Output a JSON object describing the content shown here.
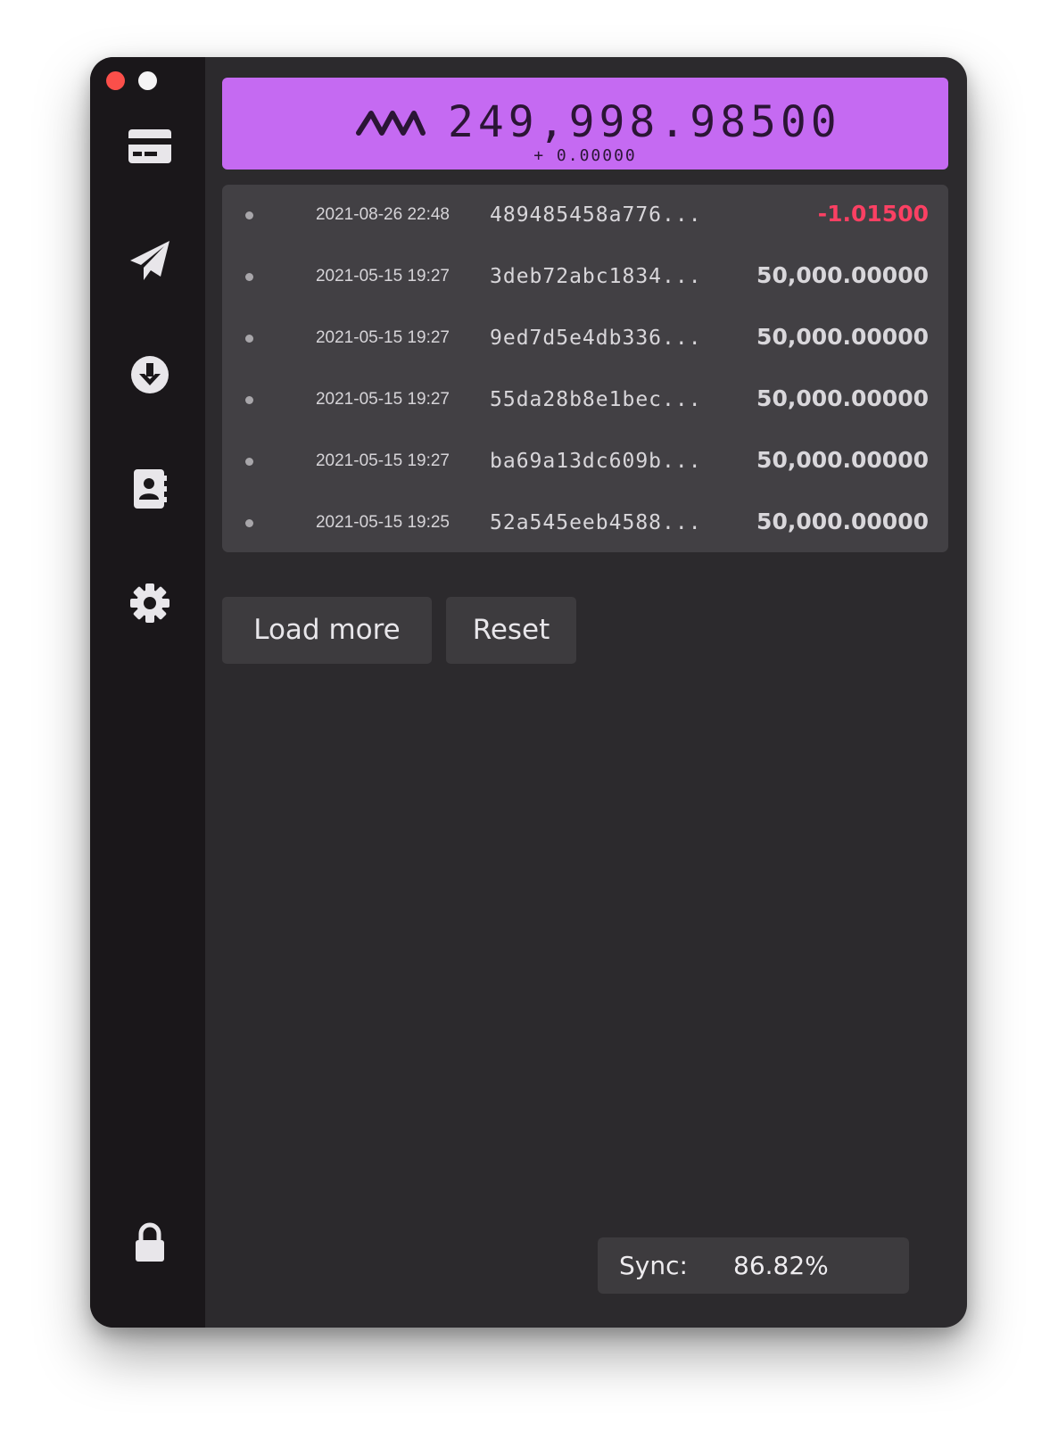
{
  "window": {
    "controls": [
      "close",
      "minimize"
    ]
  },
  "sidebar": {
    "items": [
      {
        "icon": "card-icon",
        "name": "wallet"
      },
      {
        "icon": "paper-plane-icon",
        "name": "send"
      },
      {
        "icon": "download-icon",
        "name": "receive"
      },
      {
        "icon": "contacts-icon",
        "name": "contacts"
      },
      {
        "icon": "gear-icon",
        "name": "settings"
      }
    ],
    "bottom_icon": "lock-icon"
  },
  "balance": {
    "logo": "wave-logo-icon",
    "value": "249,998.98500",
    "delta": "+ 0.00000",
    "background": "#c56af2"
  },
  "transactions": [
    {
      "date": "2021-08-26 22:48",
      "hash": "489485458a776...",
      "amount": "-1.01500",
      "negative": true
    },
    {
      "date": "2021-05-15 19:27",
      "hash": "3deb72abc1834...",
      "amount": "50,000.00000",
      "negative": false
    },
    {
      "date": "2021-05-15 19:27",
      "hash": "9ed7d5e4db336...",
      "amount": "50,000.00000",
      "negative": false
    },
    {
      "date": "2021-05-15 19:27",
      "hash": "55da28b8e1bec...",
      "amount": "50,000.00000",
      "negative": false
    },
    {
      "date": "2021-05-15 19:27",
      "hash": "ba69a13dc609b...",
      "amount": "50,000.00000",
      "negative": false
    },
    {
      "date": "2021-05-15 19:25",
      "hash": "52a545eeb4588...",
      "amount": "50,000.00000",
      "negative": false
    }
  ],
  "buttons": {
    "load_more": "Load more",
    "reset": "Reset"
  },
  "sync": {
    "label": "Sync:",
    "value": "86.82%"
  },
  "colors": {
    "negative": "#fb4063",
    "accent": "#c56af2"
  }
}
